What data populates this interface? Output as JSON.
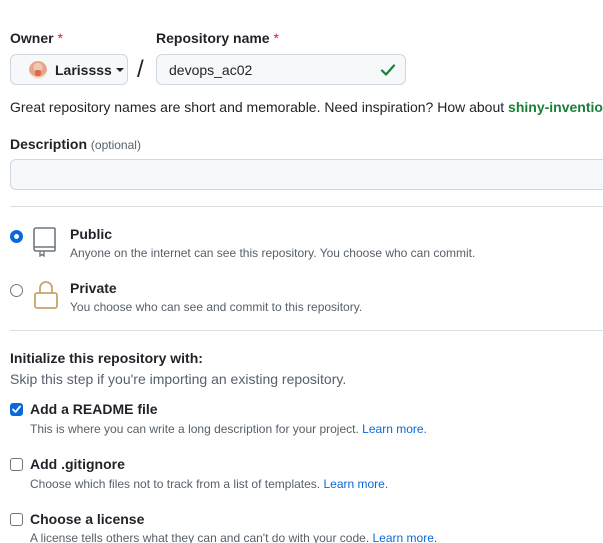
{
  "owner": {
    "label": "Owner",
    "required_mark": "*",
    "value": "Larissss"
  },
  "repo": {
    "label": "Repository name",
    "required_mark": "*",
    "value": "devops_ac02",
    "valid": true
  },
  "separator": "/",
  "suggestion": {
    "text": "Great repository names are short and memorable. Need inspiration? How about",
    "name": "shiny-invention"
  },
  "description": {
    "label": "Description",
    "optional": "(optional)",
    "value": ""
  },
  "visibility": {
    "selected": "public",
    "public": {
      "title": "Public",
      "desc": "Anyone on the internet can see this repository. You choose who can commit."
    },
    "private": {
      "title": "Private",
      "desc": "You choose who can see and commit to this repository."
    }
  },
  "init": {
    "title": "Initialize this repository with:",
    "subtitle": "Skip this step if you're importing an existing repository.",
    "readme": {
      "title": "Add a README file",
      "desc": "This is where you can write a long description for your project.",
      "link": "Learn more.",
      "checked": true
    },
    "gitignore": {
      "title": "Add .gitignore",
      "desc": "Choose which files not to track from a list of templates.",
      "link": "Learn more.",
      "checked": false
    },
    "license": {
      "title": "Choose a license",
      "desc": "A license tells others what they can and can't do with your code.",
      "link": "Learn more.",
      "checked": false
    }
  },
  "colors": {
    "accent": "#0969da",
    "success": "#1a7f37",
    "required": "#cf222e"
  }
}
